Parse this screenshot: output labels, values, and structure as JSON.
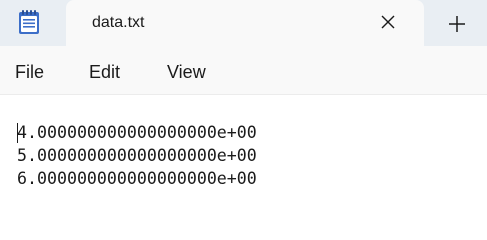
{
  "tab": {
    "title": "data.txt",
    "close_icon": "close-icon",
    "new_tab_icon": "plus-icon"
  },
  "app_icon": "notepad-icon",
  "menu": {
    "file": "File",
    "edit": "Edit",
    "view": "View"
  },
  "editor": {
    "lines": [
      "4.000000000000000000e+00",
      "5.000000000000000000e+00",
      "6.000000000000000000e+00"
    ]
  },
  "colors": {
    "titlebar_bg": "#e9eef3",
    "tab_bg": "#f9f9f9",
    "text": "#1b1b1b",
    "icon_blue": "#3c6ec8"
  }
}
